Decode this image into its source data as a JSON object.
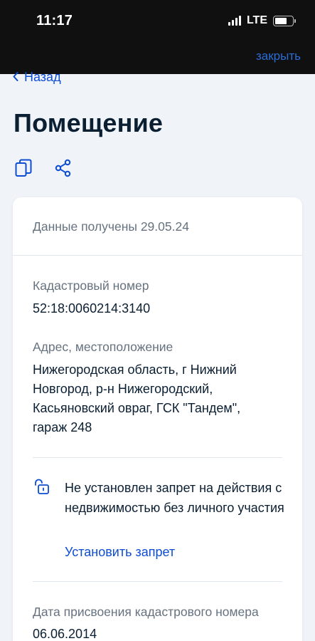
{
  "status_bar": {
    "time": "11:17",
    "network": "LTE",
    "signal_icon": "signal-bars-icon",
    "battery_icon": "battery-icon"
  },
  "modal": {
    "close_label": "закрыть"
  },
  "nav": {
    "back_label": "Назад",
    "back_icon": "chevron-left-icon"
  },
  "page": {
    "title": "Помещение",
    "actions": [
      {
        "name": "copy-icon"
      },
      {
        "name": "share-icon"
      }
    ]
  },
  "card": {
    "received": "Данные получены 29.05.24",
    "cadastral_label": "Кадастровый номер",
    "cadastral_value": "52:18:0060214:3140",
    "address_label": "Адрес, местоположение",
    "address_value": "Нижегородская область, г Нижний Новгород, р-н Нижегородский, Касьяновский овраг, ГСК \"Тандем\", гараж 248",
    "ban_notice": "Не установлен запрет на действия с недвижимостью без личного участия",
    "ban_icon": "unlocked-padlock-icon",
    "set_ban_link": "Установить запрет",
    "assign_date_label": "Дата присвоения кадастрового номера",
    "assign_date_value": "06.06.2014"
  },
  "colors": {
    "accent": "#0d4cd3",
    "text": "#0b1f33",
    "muted": "#66727f",
    "background": "#f0f4f9"
  }
}
